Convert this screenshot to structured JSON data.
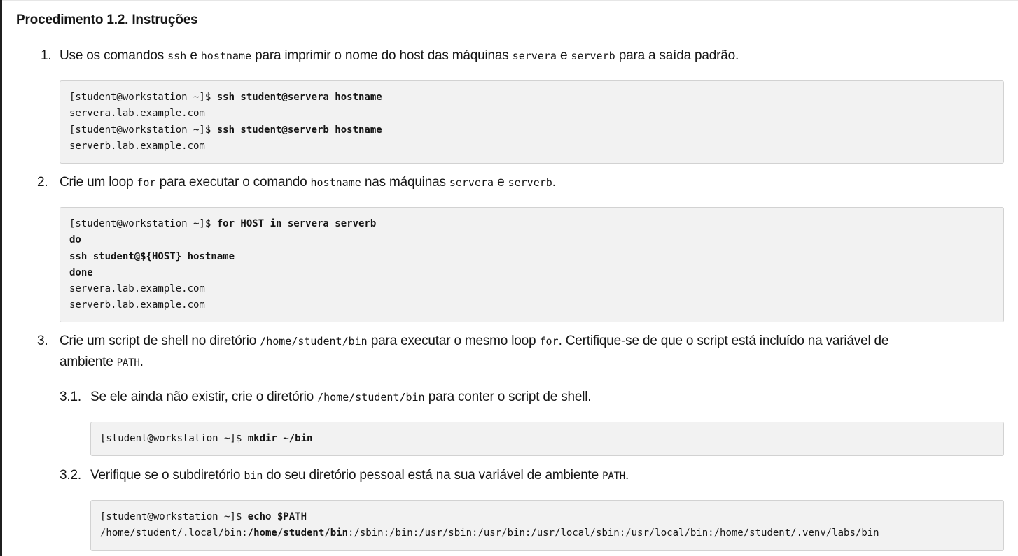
{
  "procedure_title": "Procedimento 1.2. Instruções",
  "steps": [
    {
      "number": "1.",
      "text_parts": [
        "Use os comandos ",
        "ssh",
        " e ",
        "hostname",
        " para imprimir o nome do host das máquinas ",
        "servera",
        " e ",
        "serverb",
        " para a saída padrão."
      ],
      "code": {
        "prompt1": "[student@workstation ~]$ ",
        "cmd1": "ssh student@servera hostname",
        "out1": "servera.lab.example.com",
        "prompt2": "[student@workstation ~]$ ",
        "cmd2": "ssh student@serverb hostname",
        "out2": "serverb.lab.example.com"
      }
    },
    {
      "number": "2.",
      "text_parts": [
        "Crie um loop ",
        "for",
        " para executar o comando ",
        "hostname",
        " nas máquinas ",
        "servera",
        " e ",
        "serverb",
        "."
      ],
      "code": {
        "prompt1": "[student@workstation ~]$ ",
        "cmd1": "for HOST in servera serverb",
        "line2": "do",
        "line3": "ssh student@${HOST} hostname",
        "line4": "done",
        "out1": "servera.lab.example.com",
        "out2": "serverb.lab.example.com"
      }
    },
    {
      "number": "3.",
      "text_line1_parts": [
        "Crie um script de shell no diretório ",
        "/home/student/bin",
        " para executar o mesmo loop ",
        "for",
        ". Certifique-se de que o script está incluído na variável de"
      ],
      "text_line2_parts": [
        "ambiente ",
        "PATH",
        "."
      ],
      "substeps": [
        {
          "number": "3.1.",
          "text_parts": [
            "Se ele ainda não existir, crie o diretório ",
            "/home/student/bin",
            " para conter o script de shell."
          ],
          "code": {
            "prompt1": "[student@workstation ~]$ ",
            "cmd1": "mkdir ~/bin"
          }
        },
        {
          "number": "3.2.",
          "text_parts": [
            "Verifique se o subdiretório ",
            "bin",
            " do seu diretório pessoal está na sua variável de ambiente ",
            "PATH",
            "."
          ],
          "code": {
            "prompt1": "[student@workstation ~]$ ",
            "cmd1": "echo $PATH",
            "out_pre": "/home/student/.local/bin:",
            "out_bold": "/home/student/bin",
            "out_post": ":/sbin:/bin:/usr/sbin:/usr/bin:/usr/local/sbin:/usr/local/bin:/home/student/.venv/labs/bin"
          }
        }
      ]
    }
  ]
}
